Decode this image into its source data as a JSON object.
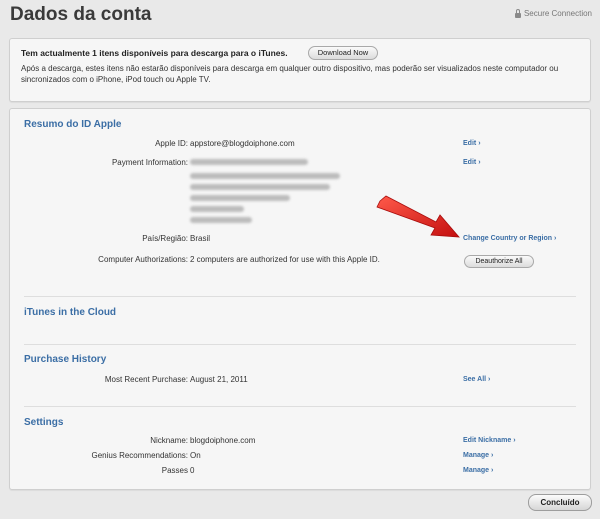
{
  "page": {
    "title": "Dados da conta",
    "secure_label": "Secure Connection"
  },
  "notice": {
    "heading": "Tem actualmente 1 itens disponíveis para descarga para o iTunes.",
    "download_label": "Download Now",
    "body": "Após a descarga, estes itens não estarão disponíveis para descarga em qualquer outro dispositivo, mas poderão ser visualizados neste computador ou sincronizados com o iPhone, iPod touch ou Apple TV."
  },
  "summary": {
    "title": "Resumo do ID Apple",
    "apple_id_label": "Apple ID:",
    "apple_id_value": "appstore@blogdoiphone.com",
    "apple_id_action": "Edit",
    "payment_label": "Payment Information:",
    "payment_action": "Edit",
    "country_label": "País/Região:",
    "country_value": "Brasil",
    "country_action": "Change Country or Region",
    "auth_label": "Computer Authorizations:",
    "auth_value": "2 computers are authorized for use with this Apple ID.",
    "auth_action": "Deauthorize All"
  },
  "cloud": {
    "title": "iTunes in the Cloud"
  },
  "purchase": {
    "title": "Purchase History",
    "recent_label": "Most Recent Purchase:",
    "recent_value": "August 21, 2011",
    "recent_action": "See All"
  },
  "settings": {
    "title": "Settings",
    "nickname_label": "Nickname:",
    "nickname_value": "blogdoiphone.com",
    "nickname_action": "Edit Nickname",
    "genius_label": "Genius Recommendations:",
    "genius_value": "On",
    "genius_action": "Manage",
    "passes_label": "Passes",
    "passes_value": "0",
    "passes_action": "Manage"
  },
  "footer": {
    "done_label": "Concluído"
  },
  "chevron": "›",
  "colors": {
    "link": "#3b6ea5",
    "arrow": "#e02020"
  }
}
